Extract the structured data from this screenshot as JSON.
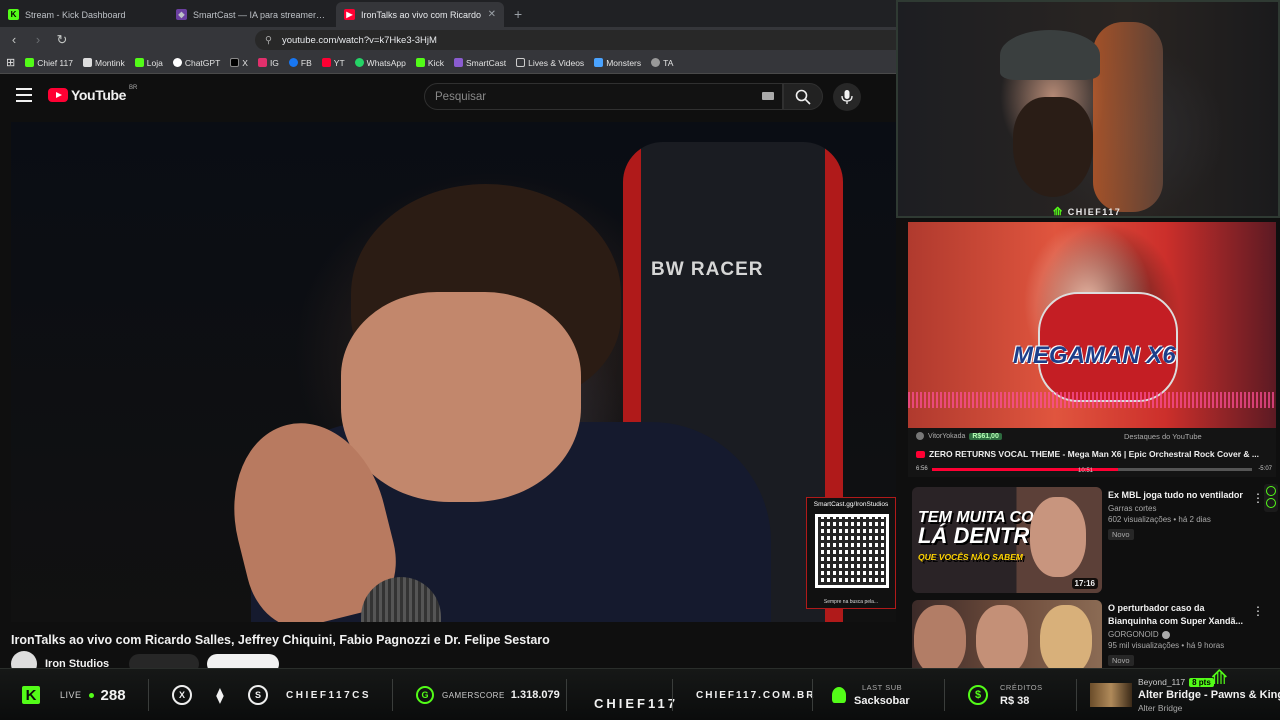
{
  "browser": {
    "tabs": [
      {
        "label": "Stream - Kick Dashboard",
        "icon": "kick-icon"
      },
      {
        "label": "SmartCast — IA para streamers e pod",
        "icon": "smartcast-icon"
      },
      {
        "label": "IronTalks ao vivo com Ricardo",
        "icon": "youtube-icon"
      }
    ],
    "url": "youtube.com/watch?v=k7Hke3-3HjM",
    "bookmarks": [
      "Chief 117",
      "Montink",
      "Loja",
      "ChatGPT",
      "X",
      "IG",
      "FB",
      "YT",
      "WhatsApp",
      "Kick",
      "SmartCast",
      "Lives & Videos",
      "Monsters",
      "TA"
    ]
  },
  "youtube": {
    "logo_text": "YouTube",
    "country": "BR",
    "search_placeholder": "Pesquisar",
    "video_title": "IronTalks ao vivo com Ricardo Salles, Jeffrey Chiquini, Fabio Pagnozzi e Dr. Felipe Sestaro",
    "channel": "Iron Studios",
    "chair_brand": "BW RACER",
    "qr_top": "SmartCast.gg/IronStudios",
    "qr_bottom": "Sempre na busca pela..."
  },
  "webcam": {
    "tag": "CHIEF117"
  },
  "featured": {
    "user": "VitorYokada",
    "amount": "R$61,00",
    "label": "Destaques do YouTube",
    "title": "ZERO RETURNS VOCAL THEME - Mega Man X6 | Epic Orchestral Rock Cover & ...",
    "time_current": "6:56",
    "time_end": "-5:07",
    "time_mid": "10:51",
    "progress": 0.58,
    "art_text": "MEGAMAN X6"
  },
  "recommendations": [
    {
      "title": "Ex MBL joga tudo no ventilador",
      "channel": "Garras cortes",
      "verified": false,
      "meta": "602 visualizações • há 2 dias",
      "badge": "Novo",
      "duration": "17:16",
      "thumb_text_1": "TEM MUITA COISA",
      "thumb_text_2": "LÁ DENTRO",
      "thumb_text_3": "QUE VOCÊS NÃO SABEM"
    },
    {
      "title": "O perturbador caso da Bianquinha com Super Xandã...",
      "channel": "GORGONOID",
      "verified": true,
      "meta": "95 mil visualizações • há 9 horas",
      "badge": "Novo"
    }
  ],
  "overlay": {
    "live_label": "LIVE",
    "viewers": "288",
    "gamertag": "CHIEF117CS",
    "gamerscore_label": "GAMERSCORE",
    "gamerscore": "1.318.079",
    "brand": "CHIEF117",
    "site": "CHIEF117.COM.BR",
    "last_sub_label": "LAST SUB",
    "last_sub": "Sacksobar",
    "credits_label": "CRÉDITOS",
    "credits": "R$ 38",
    "music_user": "Beyond_117",
    "music_pts": "8 pts",
    "music_title": "Alter Bridge - Pawns & Kings",
    "music_artist": "Alter Bridge"
  },
  "colors": {
    "kick_green": "#53fc18",
    "youtube_red": "#ff0033"
  }
}
